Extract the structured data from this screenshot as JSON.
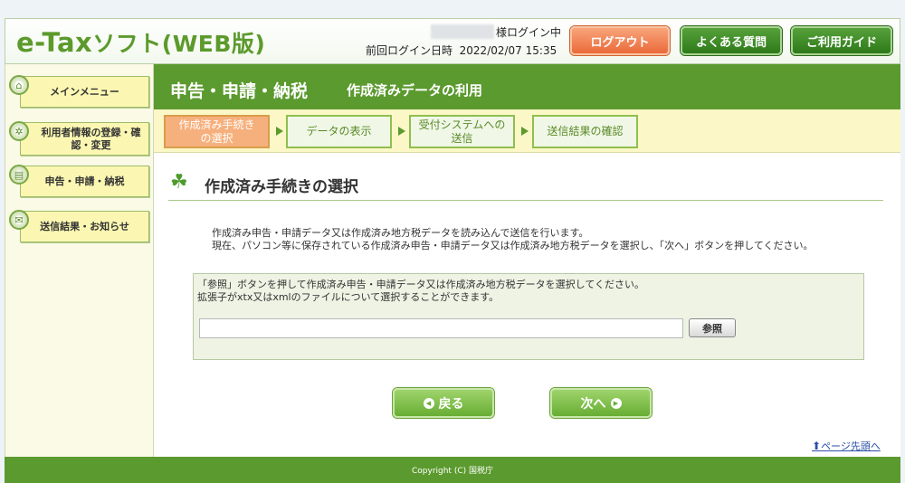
{
  "header": {
    "logo_main": "e-Tax",
    "logo_sub": "ソフト(WEB版)",
    "login_status": "様ログイン中",
    "last_login_label": "前回ログイン日時",
    "last_login_value": "2022/02/07 15:35",
    "logout_label": "ログアウト",
    "faq_label": "よくある質問",
    "guide_label": "ご利用ガイド"
  },
  "sidebar": {
    "items": [
      {
        "label": "メインメニュー",
        "icon": "home-icon"
      },
      {
        "label": "利用者情報の登録・確認・変更",
        "icon": "gear-icon"
      },
      {
        "label": "申告・申請・納税",
        "icon": "document-icon"
      },
      {
        "label": "送信結果・お知らせ",
        "icon": "mail-icon"
      }
    ]
  },
  "title": {
    "main": "申告・申請・納税",
    "sub": "作成済みデータの利用"
  },
  "steps": [
    {
      "label": "作成済み手続き\nの選択",
      "active": true
    },
    {
      "label": "データの表示",
      "active": false
    },
    {
      "label": "受付システムへの\n送信",
      "active": false
    },
    {
      "label": "送信結果の確認",
      "active": false
    }
  ],
  "content": {
    "section_title": "作成済み手続きの選択",
    "desc_line1": "作成済み申告・申請データ又は作成済み地方税データを読み込んで送信を行います。",
    "desc_line2": "現在、パソコン等に保存されている作成済み申告・申請データ又は作成済み地方税データを選択し、「次へ」ボタンを押してください。",
    "box_line1": "「参照」ボタンを押して作成済み申告・申請データ又は作成済み地方税データを選択してください。",
    "box_line2": "拡張子がxtx又はxmlのファイルについて選択することができます。",
    "file_value": "",
    "browse_label": "参照",
    "back_label": "戻る",
    "next_label": "次へ",
    "page_top_label": "ページ先頭へ"
  },
  "footer": {
    "copyright": "Copyright (C) 国税庁"
  },
  "colors": {
    "brand_green": "#5b9a2e",
    "logout_orange": "#ea6a3a",
    "active_step": "#f6b07d"
  }
}
